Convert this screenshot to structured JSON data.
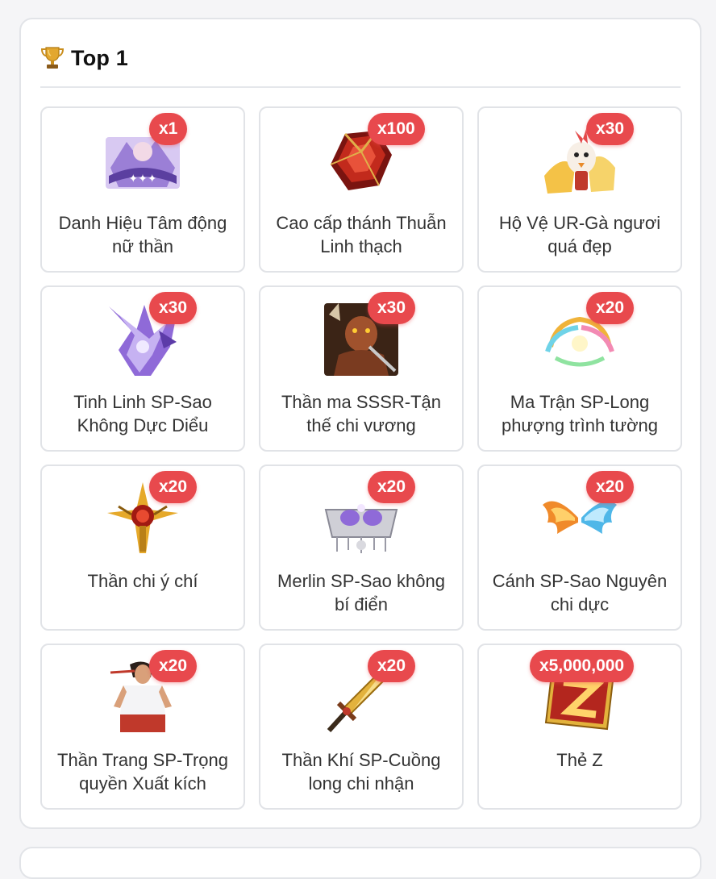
{
  "section": {
    "title": "Top 1",
    "icon": "trophy-icon"
  },
  "items": [
    {
      "qty": "x1",
      "name": "Danh Hiệu Tâm động nữ thần",
      "icon": "title-badge-icon"
    },
    {
      "qty": "x100",
      "name": "Cao cấp thánh Thuẫn Linh thạch",
      "icon": "red-gem-icon"
    },
    {
      "qty": "x30",
      "name": "Hộ Vệ UR-Gà ngươi quá đẹp",
      "icon": "chicken-guardian-icon"
    },
    {
      "qty": "x30",
      "name": "Tinh Linh SP-Sao Không Dực Diểu",
      "icon": "purple-spirit-icon"
    },
    {
      "qty": "x30",
      "name": "Thần ma SSSR-Tận thế chi vương",
      "icon": "demon-warrior-icon"
    },
    {
      "qty": "x20",
      "name": "Ma Trận SP-Long phượng trình tường",
      "icon": "rainbow-array-icon"
    },
    {
      "qty": "x20",
      "name": "Thần chi ý chí",
      "icon": "golden-sword-emblem-icon"
    },
    {
      "qty": "x20",
      "name": "Merlin SP-Sao không bí điển",
      "icon": "crystal-crown-icon"
    },
    {
      "qty": "x20",
      "name": "Cánh SP-Sao Nguyên chi dực",
      "icon": "fire-ice-wings-icon"
    },
    {
      "qty": "x20",
      "name": "Thần Trang SP-Trọng quyền Xuất kích",
      "icon": "fighter-costume-icon"
    },
    {
      "qty": "x20",
      "name": "Thần Khí SP-Cuồng long chi nhận",
      "icon": "golden-blade-icon"
    },
    {
      "qty": "x5,000,000",
      "name": "Thẻ Z",
      "icon": "z-card-icon"
    }
  ],
  "colors": {
    "badge": "#e8494d",
    "border": "#e1e3e7"
  }
}
